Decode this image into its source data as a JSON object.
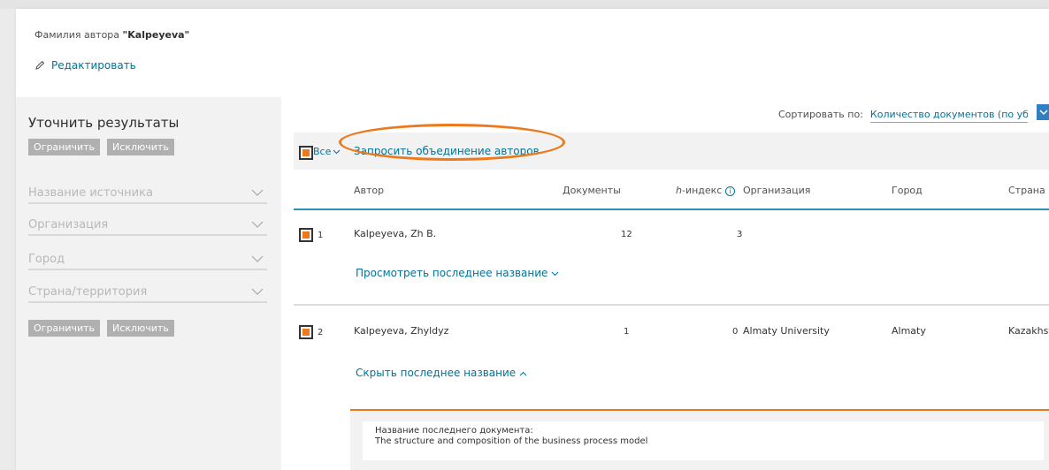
{
  "search": {
    "query_label": "Фамилия автора",
    "query_value": "\"Kalpeyeva\"",
    "edit_label": "Редактировать"
  },
  "refine": {
    "title": "Уточнить результаты",
    "limit_label": "Ограничить",
    "exclude_label": "Исключить",
    "facets": [
      {
        "label": "Название источника"
      },
      {
        "label": "Организация"
      },
      {
        "label": "Город"
      },
      {
        "label": "Страна/территория"
      }
    ]
  },
  "sort": {
    "label": "Сортировать по:",
    "value": "Количество документов (по уб..."
  },
  "toolbar": {
    "all_label": "Все",
    "merge_label": "Запросить объединение авторов"
  },
  "table": {
    "columns": {
      "author": "Автор",
      "documents": "Документы",
      "h_index_italic": "h",
      "h_index_rest": "-индекс",
      "info_icon": "i",
      "organization": "Организация",
      "city": "Город",
      "country": "Страна"
    },
    "rows": [
      {
        "index": "1",
        "author": "Kalpeyeva, Zh B.",
        "documents": "12",
        "h_index": "3",
        "organization": "",
        "city": "",
        "country": "",
        "toggle_label": "Просмотреть последнее название"
      },
      {
        "index": "2",
        "author": "Kalpeyeva, Zhyldyz",
        "documents": "1",
        "h_index": "0",
        "organization": "Almaty University",
        "city": "Almaty",
        "country": "Kazakhstan",
        "toggle_label": "Скрыть последнее название"
      }
    ],
    "latest_doc_label": "Название последнего документа:",
    "latest_doc_title": "The structure and composition of the business process model"
  },
  "colors": {
    "accent": "#ec7a1c",
    "link": "#007398",
    "header_rule": "#2f8fb8"
  }
}
